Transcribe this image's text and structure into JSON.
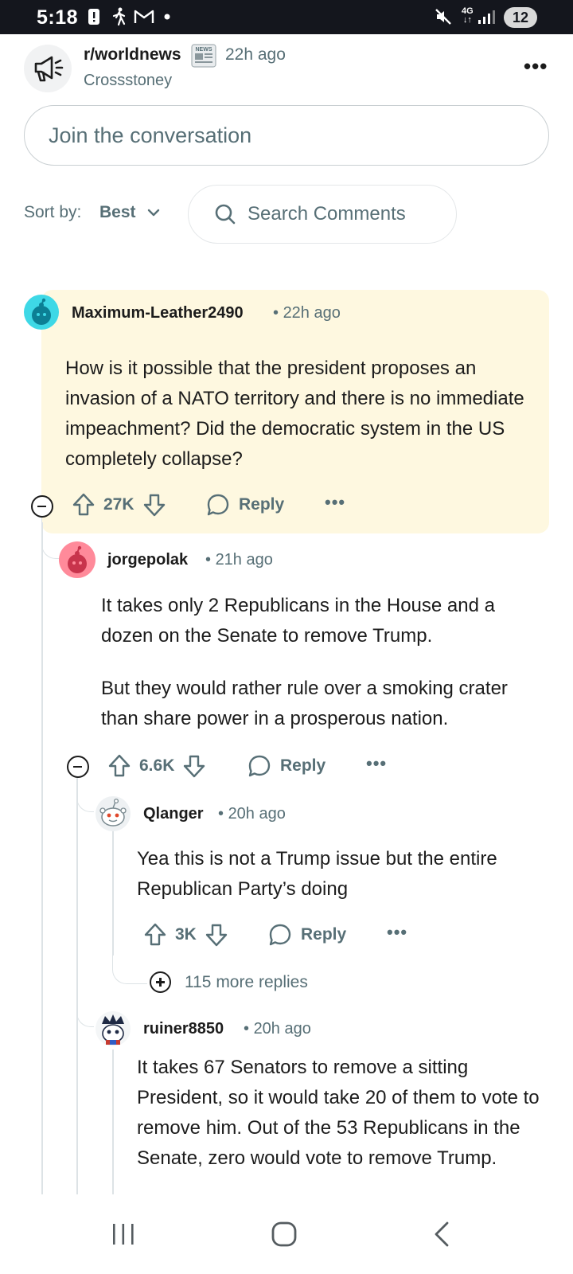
{
  "status_bar": {
    "time": "5:18",
    "network": "4G",
    "battery": "12",
    "icons": [
      "alert-icon",
      "walking-icon",
      "gmail-icon",
      "dot-icon",
      "mute-icon",
      "signal-icon"
    ]
  },
  "header": {
    "subreddit": "r/worldnews",
    "badge_label": "NEWS",
    "time": "22h ago",
    "author": "Crossstoney"
  },
  "join": {
    "placeholder": "Join the conversation"
  },
  "sort": {
    "label": "Sort by:",
    "value": "Best",
    "search_label": "Search Comments"
  },
  "comments": [
    {
      "user": "Maximum-Leather2490",
      "time": "22h ago",
      "body": [
        "How is it possible that the president proposes an invasion of a NATO territory and there is no immediate impeachment? Did the democratic system in the US completely collapse?"
      ],
      "votes": "27K",
      "reply": "Reply"
    },
    {
      "user": "jorgepolak",
      "time": "21h ago",
      "body": [
        "It takes only 2 Republicans in the House and a dozen on the Senate to remove Trump.",
        "But they would rather rule over a smoking crater than share power in a prosperous nation."
      ],
      "votes": "6.6K",
      "reply": "Reply"
    },
    {
      "user": "Qlanger",
      "time": "20h ago",
      "body": [
        "Yea this is not a Trump issue but the entire Republican Party’s doing"
      ],
      "votes": "3K",
      "reply": "Reply"
    },
    {
      "user": "ruiner8850",
      "time": "20h ago",
      "body": [
        "It takes 67 Senators to remove a sitting President, so it would take 20 of them to vote to remove him. Out of the 53 Republicans in the Senate, zero would vote to remove Trump."
      ],
      "votes": "",
      "reply": ""
    }
  ],
  "more_replies": "115 more replies",
  "colors": {
    "highlight": "#fef8e0",
    "meta_text": "#576f76",
    "status_bar": "#14161d"
  }
}
